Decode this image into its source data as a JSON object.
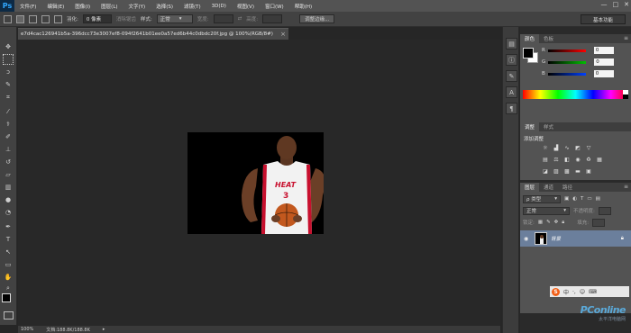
{
  "app": {
    "logo_text": "Ps"
  },
  "menu": [
    "文件(F)",
    "编辑(E)",
    "图像(I)",
    "图层(L)",
    "文字(Y)",
    "选择(S)",
    "滤镜(T)",
    "3D(D)",
    "视图(V)",
    "窗口(W)",
    "帮助(H)"
  ],
  "window_controls": {
    "minimize": "—",
    "maximize": "□",
    "close": "✕"
  },
  "options_bar": {
    "feather_label": "羽化:",
    "feather_value": "0 像素",
    "antialias_label": "消除锯齿",
    "style_label": "样式:",
    "style_value": "正常",
    "width_label": "宽度:",
    "height_label": "高度:",
    "refine_edge_button": "调整边缘...",
    "workspace_button": "基本功能"
  },
  "document": {
    "tab_title": "e7d4cac126941b5a-396dcc73e3007ef8-094f2641b01ee0a57ed6b44c0dbdc20f.jpg @ 100%(RGB/8#)",
    "close_icon": "×",
    "jersey_text": "HEAT",
    "jersey_number": "3"
  },
  "status_bar": {
    "zoom": "100%",
    "doc_info": "文档:188.8K/188.8K",
    "arrow": "▸"
  },
  "color_panel": {
    "tabs": [
      "颜色",
      "色板"
    ],
    "channels": [
      {
        "label": "R",
        "value": "0",
        "color": "#d02020"
      },
      {
        "label": "G",
        "value": "0",
        "color": "#20a020"
      },
      {
        "label": "B",
        "value": "0",
        "color": "#2040d0"
      }
    ]
  },
  "adjustments_panel": {
    "tabs": [
      "调整",
      "样式"
    ],
    "title": "添加调整"
  },
  "layers_panel": {
    "tabs": [
      "图层",
      "通道",
      "路径"
    ],
    "filter_label": "ρ 类型",
    "blend_mode": "正常",
    "opacity_label": "不透明度:",
    "lock_label": "锁定:",
    "fill_label": "填充:",
    "layer_name": "背景"
  },
  "ime": {
    "logo": "S",
    "items": [
      "中",
      "·,",
      "☺",
      "⌨"
    ]
  },
  "watermark": {
    "logo": "PConline",
    "sub": "太平洋电脑网"
  }
}
